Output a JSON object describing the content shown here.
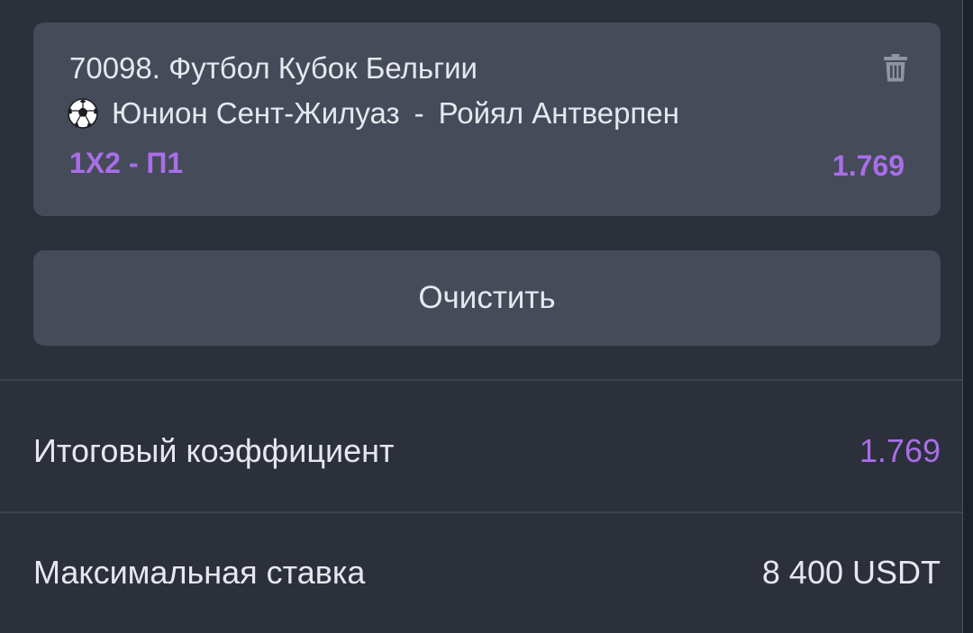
{
  "bet": {
    "header": "70098. Футбол Кубок Бельгии",
    "sport_icon": "soccer-ball-icon",
    "home_team": "Юнион Сент-Жилуаз",
    "separator": "-",
    "away_team": "Ройял Антверпен",
    "market": "1Х2 - П1",
    "odds": "1.769",
    "delete_icon": "trash-icon"
  },
  "actions": {
    "clear_label": "Очистить"
  },
  "summary": {
    "total_odds_label": "Итоговый коэффициент",
    "total_odds_value": "1.769",
    "max_stake_label": "Максимальная ставка",
    "max_stake_value": "8 400 USDT"
  },
  "colors": {
    "background": "#2b303b",
    "card": "#454b59",
    "accent": "#a96ee8",
    "text": "#e6e8ee"
  }
}
